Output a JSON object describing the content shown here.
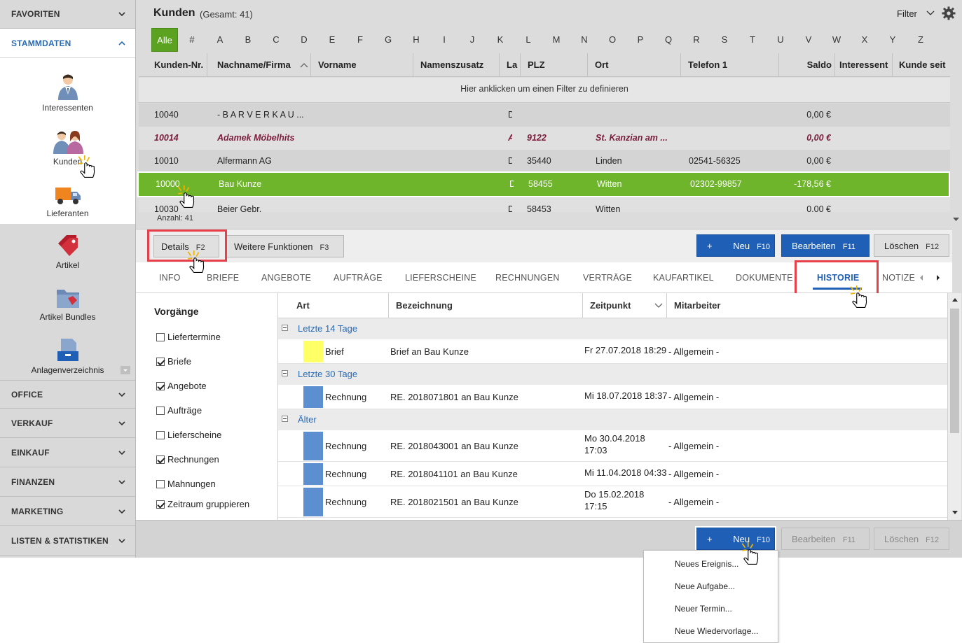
{
  "sidebar": {
    "sections_top": [
      {
        "label": "FAVORITEN"
      },
      {
        "label": "STAMMDATEN"
      }
    ],
    "items": [
      {
        "label": "Interessenten",
        "icon": "person-icon"
      },
      {
        "label": "Kunden",
        "icon": "people-icon"
      },
      {
        "label": "Lieferanten",
        "icon": "truck-icon"
      },
      {
        "label": "Artikel",
        "icon": "tag-icon"
      },
      {
        "label": "Artikel Bundles",
        "icon": "folder-tag-icon"
      },
      {
        "label": "Anlagenverzeichnis",
        "icon": "archive-icon"
      }
    ],
    "sections_bottom": [
      {
        "label": "OFFICE"
      },
      {
        "label": "VERKAUF"
      },
      {
        "label": "EINKAUF"
      },
      {
        "label": "FINANZEN"
      },
      {
        "label": "MARKETING"
      },
      {
        "label": "LISTEN & STATISTIKEN"
      }
    ]
  },
  "header": {
    "title": "Kunden",
    "count": "(Gesamt: 41)",
    "filter_label": "Filter"
  },
  "alphabet": [
    "Alle",
    "#",
    "A",
    "B",
    "C",
    "D",
    "E",
    "F",
    "G",
    "H",
    "I",
    "J",
    "K",
    "L",
    "M",
    "N",
    "O",
    "P",
    "Q",
    "R",
    "S",
    "T",
    "U",
    "V",
    "W",
    "X",
    "Y",
    "Z"
  ],
  "grid": {
    "columns": [
      "Kunden-Nr.",
      "Nachname/Firma",
      "Vorname",
      "Namenszusatz",
      "La",
      "PLZ",
      "Ort",
      "Telefon 1",
      "Saldo",
      "Interessent",
      "Kunde seit"
    ],
    "filter_hint": "Hier anklicken um einen Filter zu definieren",
    "rows": [
      {
        "nr": "10040",
        "name": "- B A R V E R K A U ...",
        "la": "D",
        "plz": "",
        "ort": "",
        "tel": "",
        "saldo": "0,00 €"
      },
      {
        "nr": "10014",
        "name": "Adamek Möbelhits",
        "la": "A",
        "plz": "9122",
        "ort": "St. Kanzian am ...",
        "tel": "",
        "saldo": "0,00 €"
      },
      {
        "nr": "10010",
        "name": "Alfermann AG",
        "la": "D",
        "plz": "35440",
        "ort": "Linden",
        "tel": "02541-56325",
        "saldo": "0,00 €"
      },
      {
        "nr": "10000",
        "name": "Bau Kunze",
        "la": "D",
        "plz": "58455",
        "ort": "Witten",
        "tel": "02302-99857",
        "saldo": "-178,56 €"
      },
      {
        "nr": "10030",
        "name": "Beier Gebr.",
        "la": "D",
        "plz": "58453",
        "ort": "Witten",
        "tel": "",
        "saldo": "0,00 €"
      }
    ],
    "anzahl": "Anzahl: 41"
  },
  "toolbar": {
    "details": "Details",
    "details_key": "F2",
    "weitere": "Weitere Funktionen",
    "weitere_key": "F3",
    "neu": "Neu",
    "neu_key": "F10",
    "bearbeiten": "Bearbeiten",
    "bearbeiten_key": "F11",
    "loeschen": "Löschen",
    "loeschen_key": "F12",
    "plus": "+"
  },
  "tabs": [
    "INFO",
    "BRIEFE",
    "ANGEBOTE",
    "AUFTRÄGE",
    "LIEFERSCHEINE",
    "RECHNUNGEN",
    "VERTRÄGE",
    "KAUFARTIKEL",
    "DOKUMENTE",
    "HISTORIE",
    "NOTIZE"
  ],
  "vorgaenge": {
    "title": "Vorgänge",
    "items": [
      {
        "label": "Liefertermine",
        "checked": false
      },
      {
        "label": "Briefe",
        "checked": true
      },
      {
        "label": "Angebote",
        "checked": true
      },
      {
        "label": "Aufträge",
        "checked": false
      },
      {
        "label": "Lieferscheine",
        "checked": false
      },
      {
        "label": "Rechnungen",
        "checked": true
      },
      {
        "label": "Mahnungen",
        "checked": false
      },
      {
        "label": "Zeitraum gruppieren",
        "checked": true
      }
    ]
  },
  "history": {
    "columns": [
      "Art",
      "Bezeichnung",
      "Zeitpunkt",
      "Mitarbeiter"
    ],
    "groups": [
      {
        "label": "Letzte 14 Tage",
        "rows": [
          {
            "art": "Brief",
            "bez": "Brief an Bau Kunze",
            "zeit1": "Fr 27.07.2018 18:29",
            "zeit2": "",
            "mit": "- Allgemein -",
            "color": "#ffff66"
          }
        ]
      },
      {
        "label": "Letzte 30 Tage",
        "rows": [
          {
            "art": "Rechnung",
            "bez": "RE. 2018071801 an Bau Kunze",
            "zeit1": "Mi 18.07.2018 18:37",
            "zeit2": "",
            "mit": "- Allgemein -",
            "color": "#5b8fd0"
          }
        ]
      },
      {
        "label": "Älter",
        "rows": [
          {
            "art": "Rechnung",
            "bez": "RE. 2018043001 an Bau Kunze",
            "zeit1": "Mo 30.04.2018",
            "zeit2": "17:03",
            "mit": "- Allgemein -",
            "color": "#5b8fd0"
          },
          {
            "art": "Rechnung",
            "bez": "RE. 2018041101 an Bau Kunze",
            "zeit1": "Mi 11.04.2018 04:33",
            "zeit2": "",
            "mit": "- Allgemein -",
            "color": "#5b8fd0"
          },
          {
            "art": "Rechnung",
            "bez": "RE. 2018021501 an Bau Kunze",
            "zeit1": "Do 15.02.2018",
            "zeit2": "17:15",
            "mit": "- Allgemein -",
            "color": "#5b8fd0"
          }
        ]
      }
    ]
  },
  "neu_menu": [
    "Neues Ereignis...",
    "Neue Aufgabe...",
    "Neuer Termin...",
    "Neue Wiedervorlage..."
  ],
  "colors": {
    "accent_blue": "#1f5fb5",
    "selection_green": "#6fb52c",
    "highlight_red": "#e8404a",
    "link_maroon": "#7a1c3c"
  }
}
